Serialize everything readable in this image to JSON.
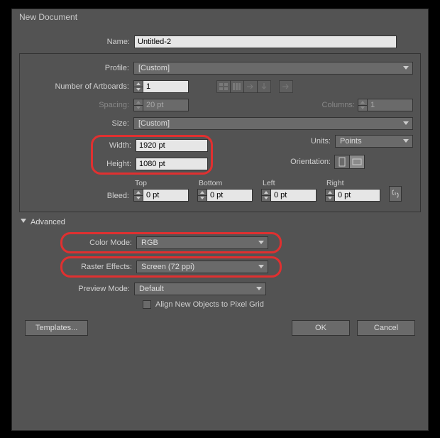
{
  "title": "New Document",
  "fields": {
    "name_label": "Name:",
    "name_value": "Untitled-2",
    "profile_label": "Profile:",
    "profile_value": "[Custom]",
    "artboards_label": "Number of Artboards:",
    "artboards_value": "1",
    "spacing_label": "Spacing:",
    "spacing_value": "20 pt",
    "columns_label": "Columns:",
    "columns_value": "1",
    "size_label": "Size:",
    "size_value": "[Custom]",
    "width_label": "Width:",
    "width_value": "1920 pt",
    "height_label": "Height:",
    "height_value": "1080 pt",
    "units_label": "Units:",
    "units_value": "Points",
    "orientation_label": "Orientation:",
    "bleed_label": "Bleed:",
    "bleed_top_label": "Top",
    "bleed_bottom_label": "Bottom",
    "bleed_left_label": "Left",
    "bleed_right_label": "Right",
    "bleed_top": "0 pt",
    "bleed_bottom": "0 pt",
    "bleed_left": "0 pt",
    "bleed_right": "0 pt"
  },
  "advanced": {
    "header": "Advanced",
    "color_mode_label": "Color Mode:",
    "color_mode_value": "RGB",
    "raster_label": "Raster Effects:",
    "raster_value": "Screen (72 ppi)",
    "preview_label": "Preview Mode:",
    "preview_value": "Default",
    "align_checkbox": "Align New Objects to Pixel Grid"
  },
  "buttons": {
    "templates": "Templates...",
    "ok": "OK",
    "cancel": "Cancel"
  }
}
